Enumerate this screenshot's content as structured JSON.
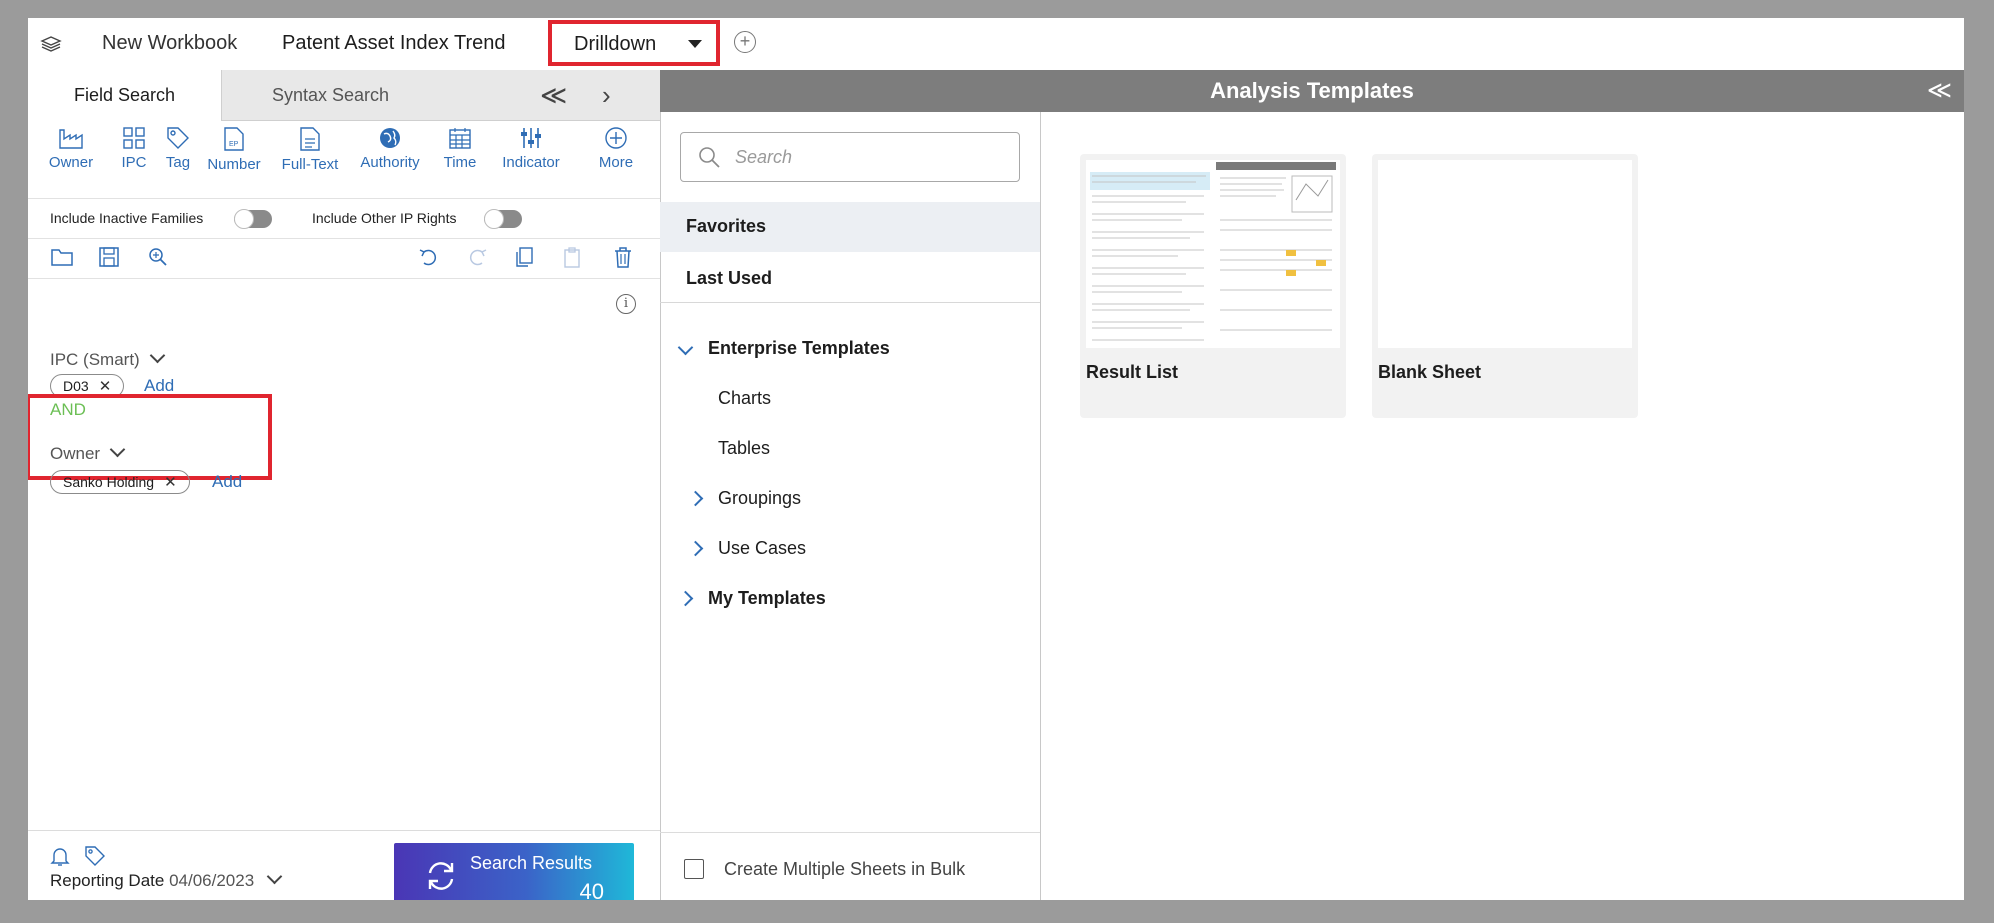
{
  "topbar": {
    "new_workbook": "New Workbook",
    "sheet_title": "Patent Asset Index Trend",
    "drilldown": "Drilldown"
  },
  "left_panel": {
    "tabs": {
      "field_search": "Field Search",
      "syntax_search": "Syntax Search"
    },
    "tools": [
      {
        "label": "Owner",
        "icon": "factory-icon"
      },
      {
        "label": "IPC",
        "icon": "grid-icon"
      },
      {
        "label": "Tag",
        "icon": "tag-icon"
      },
      {
        "label": "Number",
        "icon": "document-ep-icon"
      },
      {
        "label": "Full-Text",
        "icon": "document-icon"
      },
      {
        "label": "Authority",
        "icon": "globe-icon"
      },
      {
        "label": "Time",
        "icon": "calendar-icon"
      },
      {
        "label": "Indicator",
        "icon": "sliders-icon"
      },
      {
        "label": "More",
        "icon": "plus-circle-icon"
      }
    ],
    "toggles": {
      "inactive": "Include Inactive Families",
      "other_ip": "Include Other IP Rights"
    },
    "ipc_field": {
      "title": "IPC (Smart)",
      "chip": "D03",
      "add": "Add"
    },
    "operator": "AND",
    "owner_field": {
      "title": "Owner",
      "chip": "Sanko Holding",
      "add": "Add"
    },
    "reporting": {
      "label": "Reporting Date",
      "value": "04/06/2023"
    },
    "search_button": {
      "label": "Search Results",
      "count": "40"
    }
  },
  "analysis": {
    "title": "Analysis Templates",
    "search_placeholder": "Search",
    "favorites": "Favorites",
    "last_used": "Last Used",
    "enterprise": "Enterprise Templates",
    "charts": "Charts",
    "tables": "Tables",
    "groupings": "Groupings",
    "use_cases": "Use Cases",
    "my_templates": "My Templates",
    "bulk": "Create Multiple Sheets in Bulk",
    "cards": {
      "result_list": "Result List",
      "blank_sheet": "Blank Sheet"
    }
  },
  "colors": {
    "highlight": "#e0252f",
    "link": "#2f6db5",
    "and": "#6cbf55",
    "header": "#7d7d7d"
  }
}
